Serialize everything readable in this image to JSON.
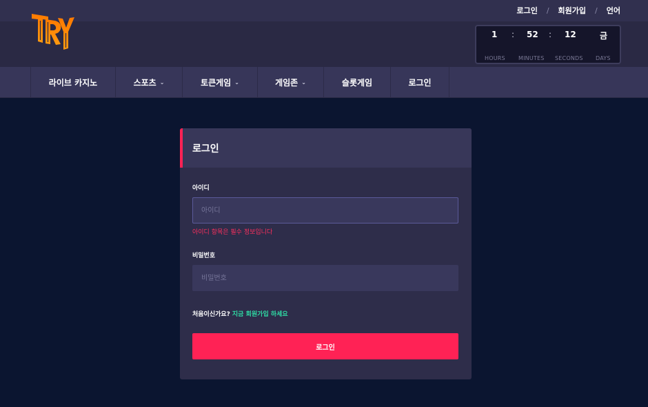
{
  "colors": {
    "background": "#0b1530",
    "nav": "#373659",
    "card": "#2e2d4a",
    "accent": "#ff2255",
    "link": "#2fd9a3",
    "logo": "#ff8c00"
  },
  "top_links": [
    "로그인",
    "회원가입",
    "언어"
  ],
  "logo": {
    "icon": "try-logo",
    "text": "TRY"
  },
  "countdown": {
    "hours": "1",
    "minutes": "52",
    "seconds": "12",
    "day": "금",
    "labels": {
      "hours": "HOURS",
      "minutes": "MINUTES",
      "seconds": "SECONDS",
      "days": "DAYS"
    }
  },
  "nav": [
    {
      "label": "라이브 카지노",
      "dropdown": false
    },
    {
      "label": "스포츠",
      "dropdown": true
    },
    {
      "label": "토큰게임",
      "dropdown": true
    },
    {
      "label": "게임존",
      "dropdown": true
    },
    {
      "label": "슬롯게임",
      "dropdown": false
    },
    {
      "label": "로그인",
      "dropdown": false
    }
  ],
  "login": {
    "title": "로그인",
    "id_label": "아이디",
    "id_placeholder": "아이디",
    "id_error": "아이디 항목은 필수 정보입니다",
    "pw_label": "비밀번호",
    "pw_placeholder": "비밀번호",
    "signup_question": "처음이신가요?",
    "signup_link": "지금 회원가입 하세요",
    "submit_label": "로그인"
  }
}
